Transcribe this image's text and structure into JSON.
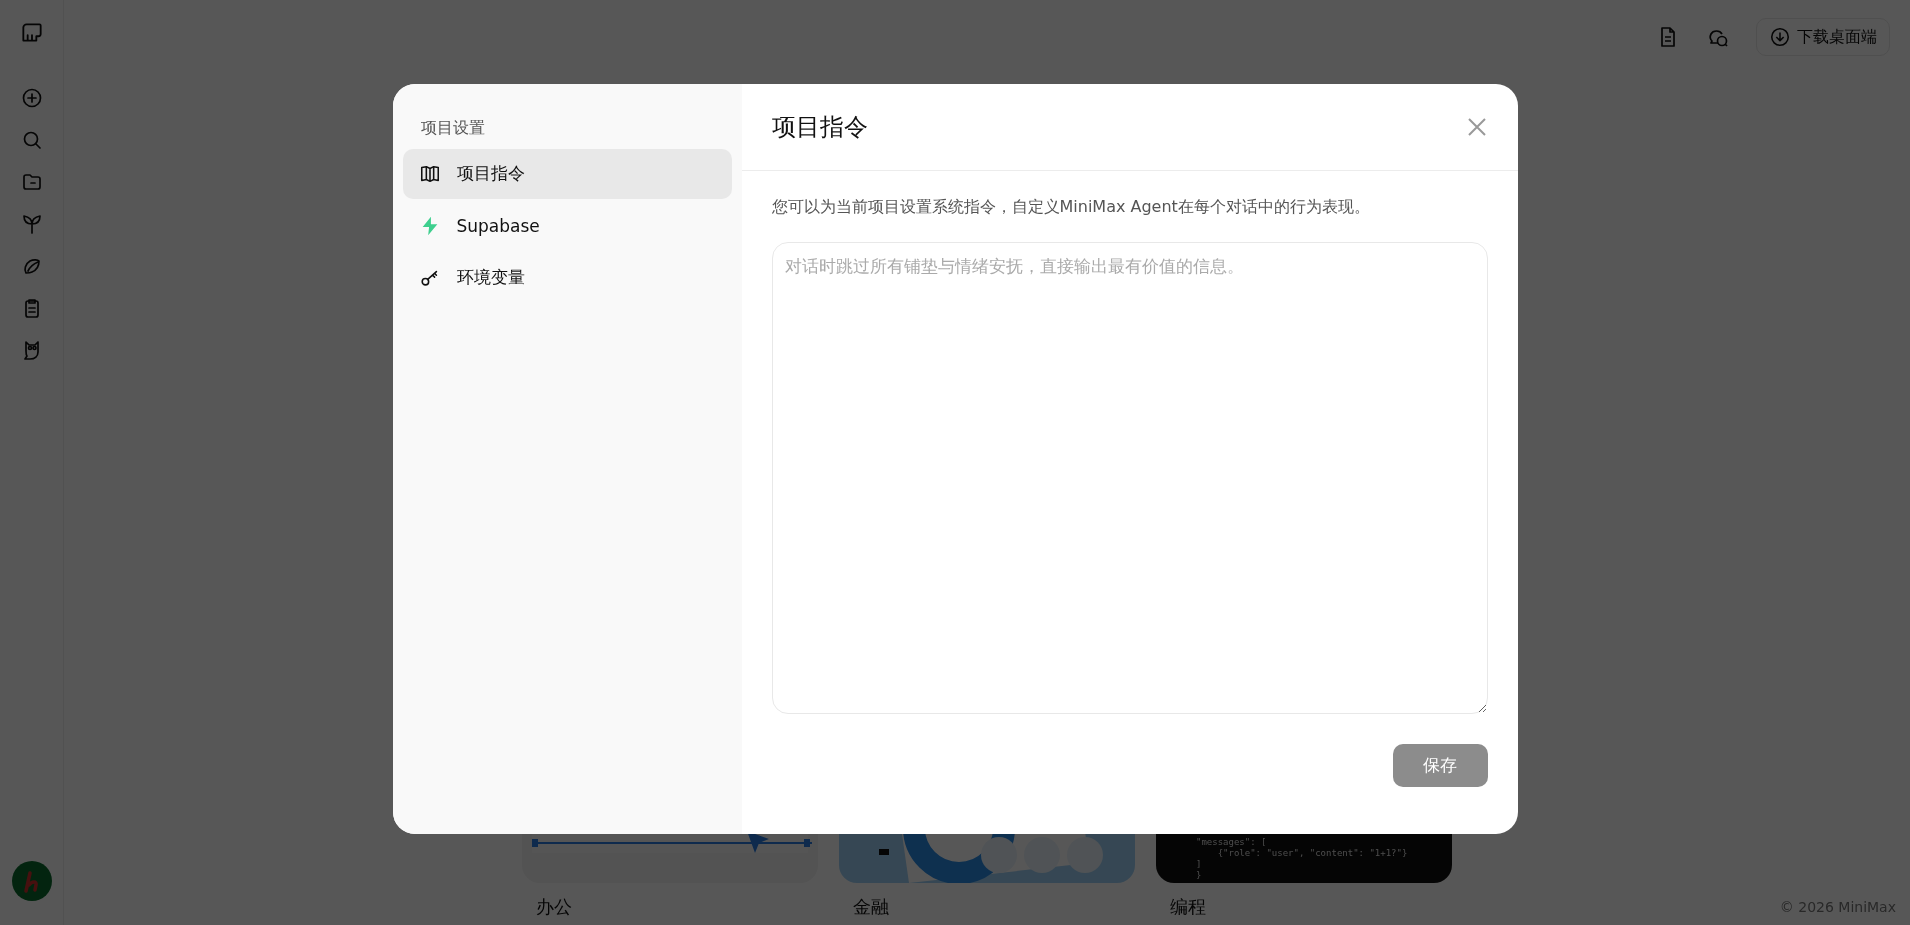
{
  "topbar": {
    "download_button": "下载桌面端"
  },
  "cards": [
    {
      "label": "办公",
      "kind": "picture"
    },
    {
      "label": "金融",
      "kind": "picture"
    },
    {
      "label": "编程",
      "kind": "code",
      "code_lines": [
        "\"messages\": [",
        "    {\"role\": \"user\", \"content\": \"1+1?\"}",
        "]",
        "}"
      ]
    }
  ],
  "copyright": "© 2026 MiniMax",
  "dialog": {
    "sidebar_title": "项目设置",
    "nav": [
      {
        "label": "项目指令",
        "selected": true
      },
      {
        "label": "Supabase",
        "selected": false
      },
      {
        "label": "环境变量",
        "selected": false
      }
    ],
    "title": "项目指令",
    "description": "您可以为当前项目设置系统指令，自定义MiniMax Agent在每个对话中的行为表现。",
    "instructions_field": {
      "placeholder": "对话时跳过所有铺垫与情绪安抚，直接输出最有价值的信息。"
    },
    "save_button": "保存"
  }
}
